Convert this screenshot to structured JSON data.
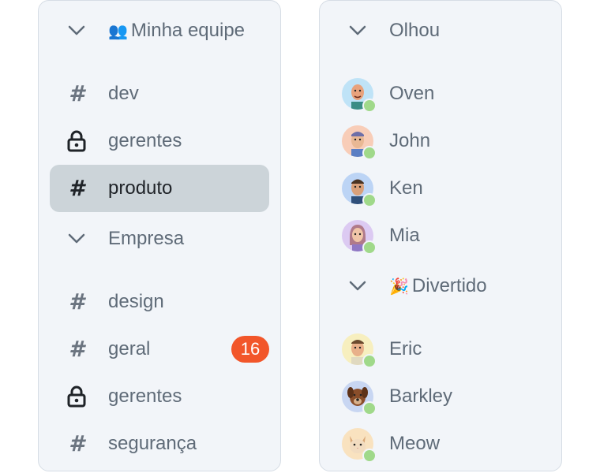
{
  "left": {
    "sections": [
      {
        "title": "Minha equipe",
        "emoji": "👥",
        "channels": [
          {
            "name": "dev",
            "icon": "hash-icon"
          },
          {
            "name": "gerentes",
            "icon": "lock-icon"
          },
          {
            "name": "produto",
            "icon": "hash-icon",
            "selected": true
          }
        ]
      },
      {
        "title": "Empresa",
        "channels": [
          {
            "name": "design",
            "icon": "hash-icon"
          },
          {
            "name": "geral",
            "icon": "hash-icon",
            "badge": "16"
          },
          {
            "name": "gerentes",
            "icon": "lock-icon"
          },
          {
            "name": "segurança",
            "icon": "hash-icon"
          }
        ]
      }
    ]
  },
  "right": {
    "sections": [
      {
        "title": "Olhou",
        "users": [
          {
            "name": "Oven",
            "avatar_bg": "#bfe3f7",
            "status": "online"
          },
          {
            "name": "John",
            "avatar_bg": "#f8cdb8",
            "status": "online"
          },
          {
            "name": "Ken",
            "avatar_bg": "#bcd4f5",
            "status": "online"
          },
          {
            "name": "Mia",
            "avatar_bg": "#dccaf2",
            "status": "online"
          }
        ]
      },
      {
        "title": "Divertido",
        "emoji": "🎉",
        "users": [
          {
            "name": "Eric",
            "avatar_bg": "#f7efbf",
            "status": "online"
          },
          {
            "name": "Barkley",
            "avatar_bg": "#c8d6f2",
            "status": "online"
          },
          {
            "name": "Meow",
            "avatar_bg": "#f9e2bf",
            "status": "online"
          }
        ]
      }
    ]
  },
  "colors": {
    "panel_bg": "#f2f5f9",
    "selected_bg": "#ccd4d9",
    "badge": "#f2562a",
    "online": "#a0d98a"
  }
}
